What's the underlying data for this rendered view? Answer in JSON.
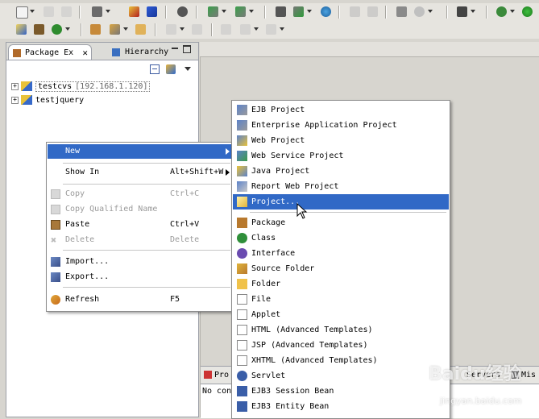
{
  "colors": {
    "accent": "#3169c6",
    "menu_bg": "#ffffff",
    "workbench_bg": "#d7d5cf"
  },
  "toolbar": {
    "row1_icons": [
      "new-wizard-icon",
      "save-icon",
      "save-all-icon",
      "open-type-icon",
      "server-icon",
      "deploy-icon",
      "database-icon",
      "pencil-icon",
      "web-icon",
      "run-server-icon",
      "search-globe-icon",
      "cut-icon",
      "palette-icon",
      "properties-icon",
      "image-icon",
      "camera-icon",
      "gear-debug-icon",
      "run-icon"
    ],
    "row2_icons": [
      "new-project-icon",
      "package-icon",
      "refresh-run-icon",
      "open-folder-icon",
      "edit-icon",
      "folder-open-icon",
      "nav-down-icon",
      "nav-up-icon",
      "back-icon",
      "forward-icon",
      "history-icon"
    ]
  },
  "package_explorer": {
    "tab_label": "Package Ex",
    "hierarchy_tab_label": "Hierarchy",
    "projects": [
      {
        "name": "testcvs",
        "decoration": "[192.168.1.120]"
      },
      {
        "name": "testjquery",
        "decoration": ""
      }
    ]
  },
  "context_menu": {
    "items": [
      {
        "label": "New",
        "accel": "",
        "submenu": true,
        "highlighted": true
      },
      {
        "label": "Show In",
        "accel": "Alt+Shift+W",
        "submenu": true
      },
      {
        "label": "Copy",
        "accel": "Ctrl+C",
        "disabled": true
      },
      {
        "label": "Copy Qualified Name",
        "accel": "",
        "disabled": true
      },
      {
        "label": "Paste",
        "accel": "Ctrl+V"
      },
      {
        "label": "Delete",
        "accel": "Delete",
        "disabled": true
      },
      {
        "label": "Import...",
        "accel": ""
      },
      {
        "label": "Export...",
        "accel": ""
      },
      {
        "label": "Refresh",
        "accel": "F5"
      }
    ]
  },
  "new_submenu": {
    "items": [
      "EJB Project",
      "Enterprise Application Project",
      "Web Project",
      "Web Service Project",
      "Java Project",
      "Report Web Project",
      "Project...",
      "Package",
      "Class",
      "Interface",
      "Source Folder",
      "Folder",
      "File",
      "Applet",
      "HTML (Advanced Templates)",
      "JSP (Advanced Templates)",
      "XHTML (Advanced Templates)",
      "Servlet",
      "EJB3 Session Bean",
      "EJB3 Entity Bean"
    ],
    "highlighted_index": 6
  },
  "bottom_view": {
    "tabs": [
      "Pro",
      "Servers",
      "Mis"
    ],
    "status_text": "No cons"
  },
  "watermark": {
    "text": "Baidu经验",
    "sub": "jingyan.baidu.com"
  }
}
